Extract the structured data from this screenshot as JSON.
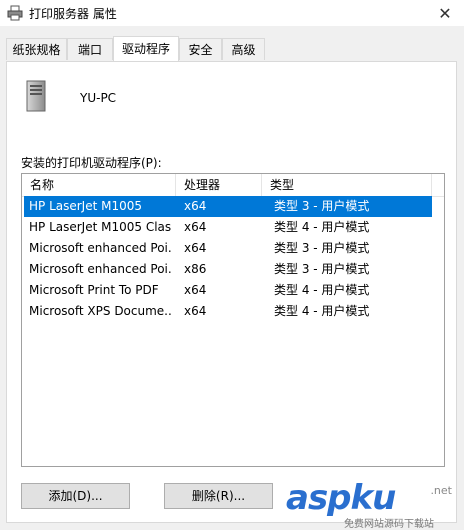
{
  "window": {
    "title": "打印服务器 属性",
    "close_glyph": "✕"
  },
  "tabs": [
    {
      "label": "纸张规格",
      "active": false
    },
    {
      "label": "端口",
      "active": false
    },
    {
      "label": "驱动程序",
      "active": true
    },
    {
      "label": "安全",
      "active": false
    },
    {
      "label": "高级",
      "active": false
    }
  ],
  "server": {
    "computer_name": "YU-PC"
  },
  "drivers": {
    "label": "安装的打印机驱动程序(P):",
    "columns": [
      "名称",
      "处理器",
      "类型"
    ],
    "rows": [
      {
        "name": "HP LaserJet M1005",
        "processor": "x64",
        "type": "类型 3 - 用户模式",
        "selected": true
      },
      {
        "name": "HP LaserJet M1005 Clas...",
        "processor": "x64",
        "type": "类型 4 - 用户模式",
        "selected": false
      },
      {
        "name": "Microsoft enhanced Poi...",
        "processor": "x64",
        "type": "类型 3 - 用户模式",
        "selected": false
      },
      {
        "name": "Microsoft enhanced Poi...",
        "processor": "x86",
        "type": "类型 3 - 用户模式",
        "selected": false
      },
      {
        "name": "Microsoft Print To PDF",
        "processor": "x64",
        "type": "类型 4 - 用户模式",
        "selected": false
      },
      {
        "name": "Microsoft XPS Docume...",
        "processor": "x64",
        "type": "类型 4 - 用户模式",
        "selected": false
      }
    ]
  },
  "buttons": {
    "add": "添加(D)...",
    "remove": "删除(R)..."
  },
  "watermark": {
    "brand": "aspku",
    "domain_suffix": ".net",
    "tagline": "免费网站源码下载站"
  },
  "colors": {
    "selection": "#0078d7",
    "watermark": "#2a6fcf"
  }
}
